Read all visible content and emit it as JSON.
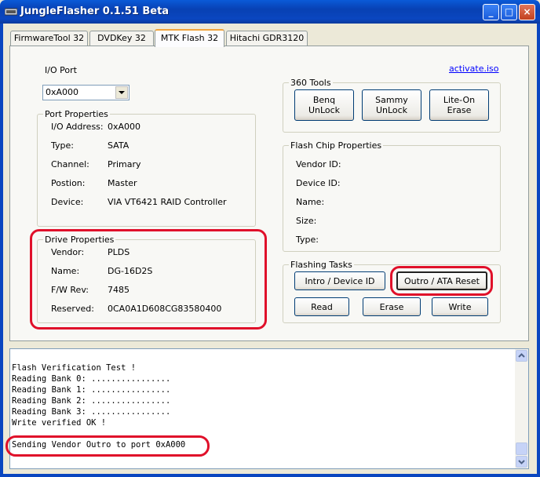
{
  "window": {
    "title": "JungleFlasher 0.1.51 Beta",
    "min_glyph": "_",
    "max_glyph": "□",
    "close_glyph": "×"
  },
  "tabs": [
    {
      "label": "FirmwareTool 32"
    },
    {
      "label": "DVDKey 32"
    },
    {
      "label": "MTK Flash 32",
      "active": true
    },
    {
      "label": "Hitachi GDR3120"
    }
  ],
  "io_port": {
    "label": "I/O Port",
    "value": "0xA000"
  },
  "activate_link": "activate.iso",
  "port_properties": {
    "title": "Port Properties",
    "rows": [
      {
        "label": "I/O Address:",
        "value": "0xA000"
      },
      {
        "label": "Type:",
        "value": "SATA"
      },
      {
        "label": "Channel:",
        "value": "Primary"
      },
      {
        "label": "Postion:",
        "value": "Master"
      },
      {
        "label": "Device:",
        "value": "VIA VT6421 RAID Controller"
      }
    ]
  },
  "drive_properties": {
    "title": "Drive Properties",
    "rows": [
      {
        "label": "Vendor:",
        "value": "PLDS"
      },
      {
        "label": "Name:",
        "value": "DG-16D2S"
      },
      {
        "label": "F/W Rev:",
        "value": "7485"
      },
      {
        "label": "Reserved:",
        "value": "0CA0A1D608CG83580400"
      }
    ]
  },
  "tools_360": {
    "title": "360 Tools",
    "buttons": [
      {
        "line1": "Benq",
        "line2": "UnLock"
      },
      {
        "line1": "Sammy",
        "line2": "UnLock"
      },
      {
        "line1": "Lite-On",
        "line2": "Erase"
      }
    ]
  },
  "flash_chip": {
    "title": "Flash Chip Properties",
    "rows": [
      {
        "label": "Vendor ID:"
      },
      {
        "label": "Device ID:"
      },
      {
        "label": "Name:"
      },
      {
        "label": "Size:"
      },
      {
        "label": "Type:"
      }
    ]
  },
  "flashing_tasks": {
    "title": "Flashing Tasks",
    "intro_label": "Intro / Device ID",
    "outro_label": "Outro / ATA Reset",
    "read_label": "Read",
    "erase_label": "Erase",
    "write_label": "Write"
  },
  "log_lines": [
    "Flash Verification Test !",
    "Reading Bank 0: ................",
    "Reading Bank 1: ................",
    "Reading Bank 2: ................",
    "Reading Bank 3: ................",
    "Write verified OK !",
    "",
    "Sending Vendor Outro to port 0xA000"
  ],
  "colors": {
    "highlight": "#e0102a",
    "title_bar": "#0a46c0",
    "tab_accent": "#f1a33c",
    "link": "#0000ff"
  },
  "icons": [
    "app-icon",
    "dropdown-arrow-icon",
    "scroll-up-icon",
    "scroll-down-icon"
  ]
}
